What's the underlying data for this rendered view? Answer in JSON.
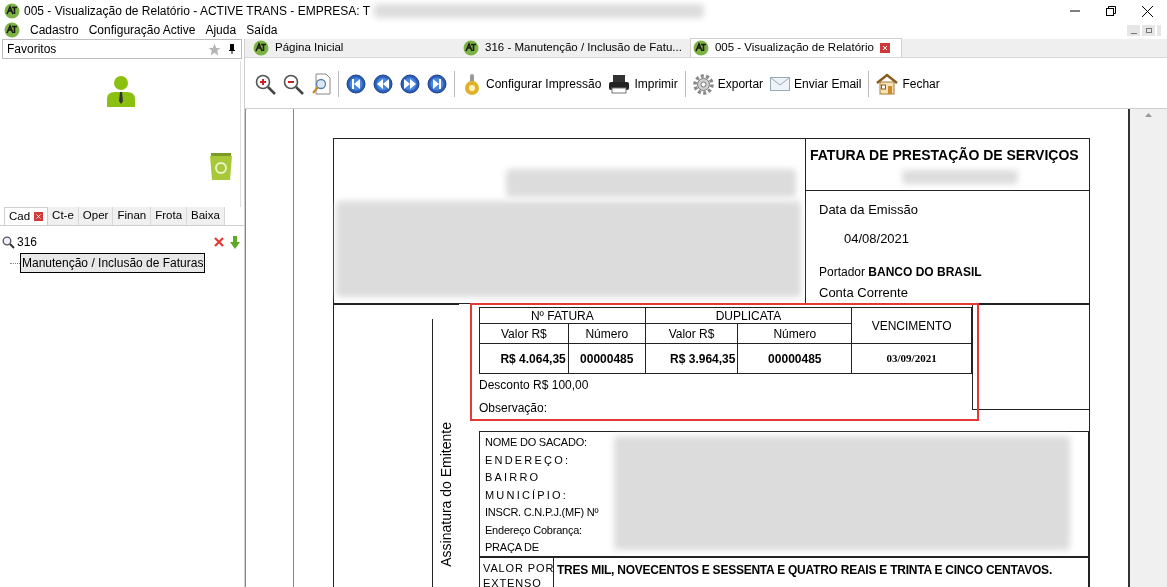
{
  "window": {
    "title": "005 - Visualização de Relatório - ACTIVE TRANS - EMPRESA: T"
  },
  "menu": [
    "Cadastro",
    "Configuração Active",
    "Ajuda",
    "Saída"
  ],
  "favorites": {
    "title": "Favoritos"
  },
  "sidebar_tabs": [
    {
      "label": "Cad",
      "selected": true,
      "closable": true
    },
    {
      "label": "Ct-e",
      "selected": false,
      "closable": false
    },
    {
      "label": "Oper",
      "selected": false,
      "closable": false
    },
    {
      "label": "Finan",
      "selected": false,
      "closable": false
    },
    {
      "label": "Frota",
      "selected": false,
      "closable": false
    },
    {
      "label": "Baixa",
      "selected": false,
      "closable": false
    }
  ],
  "search": {
    "value": "316"
  },
  "tree": [
    {
      "label": "Manutenção / Inclusão de Faturas",
      "selected": true
    }
  ],
  "doc_tabs": [
    {
      "label": "Página Inicial",
      "selected": false,
      "closable": false
    },
    {
      "label": "316 - Manutenção / Inclusão de Fatu...",
      "selected": false,
      "closable": false
    },
    {
      "label": "005 - Visualização de Relatório",
      "selected": true,
      "closable": true
    }
  ],
  "toolbar_buttons": [
    "Configurar Impressão",
    "Imprimir",
    "Exportar",
    "Enviar Email",
    "Fechar"
  ],
  "report": {
    "title": "FATURA DE PRESTAÇÃO DE SERVIÇOS",
    "emission_label": "Data da Emissão",
    "emission_date": "04/08/2021",
    "portador": "Portador **BANCO DO BRASIL**",
    "account": "Conta Corrente",
    "signature_label": "Assinatura do Emitente",
    "invoice_table": {
      "group_headers": [
        "Nº FATURA",
        "DUPLICATA",
        "VENCIMENTO"
      ],
      "columns": [
        "Valor R$",
        "Número",
        "Valor R$",
        "Número"
      ],
      "row": [
        "R$ 4.064,35",
        "00000485",
        "R$ 3.964,35",
        "00000485",
        "03/09/2021"
      ]
    },
    "discount": "Desconto R$ 100,00",
    "observation": "Observação:",
    "sacado_labels": [
      {
        "label": "NOME DO SACADO:",
        "spaced": false
      },
      {
        "label": "ENDEREÇO:",
        "spaced": true
      },
      {
        "label": "BAIRRO",
        "spaced": true
      },
      {
        "label": "MUNICÍPIO:",
        "spaced": true
      },
      {
        "label": "INSCR. C.N.P.J.(MF) Nº",
        "spaced": false
      },
      {
        "label": "Endereço Cobrança:",
        "spaced": false
      },
      {
        "label": "PRAÇA DE",
        "spaced": false
      }
    ],
    "amount_label": [
      "VALOR POR",
      "EXTENSO"
    ],
    "amount_words": "TRES MIL, NOVECENTOS E SESSENTA E QUATRO REAIS E TRINTA E CINCO CENTAVOS."
  }
}
